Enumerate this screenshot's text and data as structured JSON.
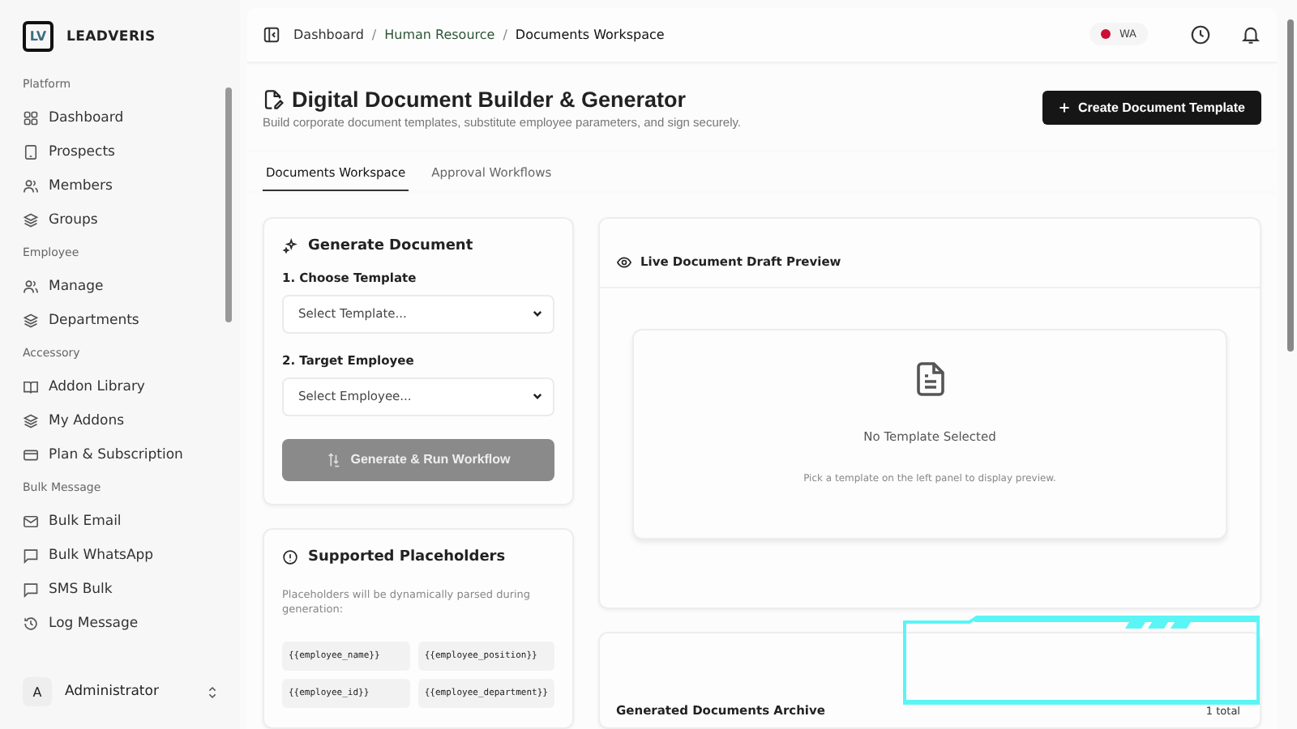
{
  "brand": {
    "logo": "LV",
    "name": "LEADVERIS"
  },
  "sidebar": {
    "sections": [
      {
        "title": "Platform",
        "items": [
          {
            "label": "Dashboard",
            "kind": "grid"
          },
          {
            "label": "Prospects",
            "kind": "tablet"
          },
          {
            "label": "Members",
            "kind": "users"
          },
          {
            "label": "Groups",
            "kind": "layers"
          }
        ]
      },
      {
        "title": "Employee",
        "items": [
          {
            "label": "Manage",
            "kind": "users"
          },
          {
            "label": "Departments",
            "kind": "layers"
          }
        ]
      },
      {
        "title": "Accessory",
        "items": [
          {
            "label": "Addon Library",
            "kind": "book"
          },
          {
            "label": "My Addons",
            "kind": "layers"
          },
          {
            "label": "Plan & Subscription",
            "kind": "card"
          }
        ]
      },
      {
        "title": "Bulk Message",
        "items": [
          {
            "label": "Bulk Email",
            "kind": "mail"
          },
          {
            "label": "Bulk WhatsApp",
            "kind": "chat"
          },
          {
            "label": "SMS Bulk",
            "kind": "chat"
          },
          {
            "label": "Log Message",
            "kind": "history"
          }
        ]
      }
    ]
  },
  "user": {
    "initial": "A",
    "name": "Administrator"
  },
  "breadcrumb": [
    "Dashboard",
    "Human Resource",
    "Documents Workspace"
  ],
  "breadcrumb_separator": "/",
  "status": {
    "label": "WA",
    "connected": false
  },
  "header": {
    "title": "Digital Document Builder & Generator",
    "subtitle": "Build corporate document templates, substitute employee parameters, and sign securely.",
    "button": "Create Document Template"
  },
  "tabs": [
    {
      "label": "Documents Workspace",
      "selected": true
    },
    {
      "label": "Approval Workflows",
      "selected": false
    }
  ],
  "generate": {
    "title": "Generate Document",
    "fields": [
      {
        "label": "1. Choose Template",
        "placeholder": "Select Template..."
      },
      {
        "label": "2. Target Employee",
        "placeholder": "Select Employee..."
      }
    ],
    "button": {
      "label": "Generate & Run Workflow",
      "disabled": true
    }
  },
  "placeholders": {
    "title": "Supported Placeholders",
    "note": "Placeholders will be dynamically parsed during generation:",
    "items": [
      "{{employee_name}}",
      "{{employee_position}}",
      "{{employee_id}}",
      "{{employee_department}}"
    ]
  },
  "preview": {
    "title": "Live Document Draft Preview",
    "empty_title": "No Template Selected",
    "empty_text": "Pick a template on the left panel to display preview."
  },
  "archive": {
    "title": "Generated Documents Archive",
    "count": "1 total"
  }
}
